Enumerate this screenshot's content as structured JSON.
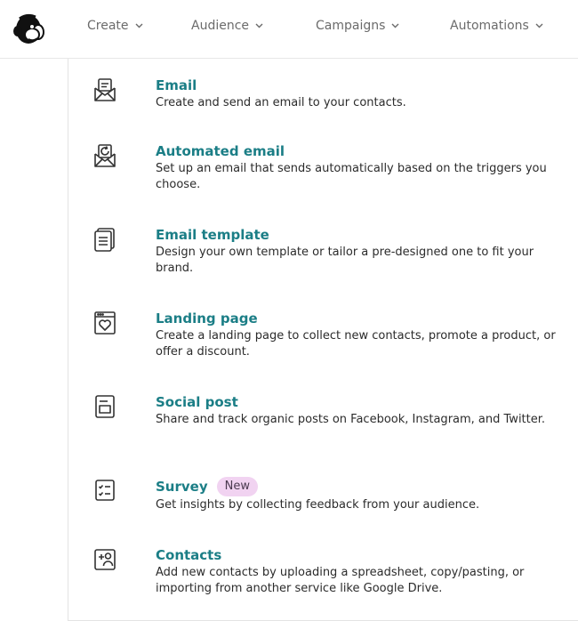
{
  "nav": {
    "items": [
      {
        "label": "Create"
      },
      {
        "label": "Audience"
      },
      {
        "label": "Campaigns"
      },
      {
        "label": "Automations"
      }
    ]
  },
  "menu": {
    "items": [
      {
        "title": "Email",
        "description": "Create and send an email to your contacts.",
        "icon": "envelope-icon"
      },
      {
        "title": "Automated email",
        "description": "Set up an email that sends automatically based on the triggers you choose.",
        "icon": "automated-email-icon"
      },
      {
        "title": "Email template",
        "description": "Design your own template or tailor a pre-designed one to fit your brand.",
        "icon": "template-icon"
      },
      {
        "title": "Landing page",
        "description": "Create a landing page to collect new contacts, promote a product, or offer a discount.",
        "icon": "landing-page-icon"
      },
      {
        "title": "Social post",
        "description": "Share and track organic posts on Facebook, Instagram, and Twitter.",
        "icon": "social-post-icon"
      },
      {
        "title": "Survey",
        "badge": "New",
        "description": "Get insights by collecting feedback from your audience.",
        "icon": "survey-icon"
      },
      {
        "title": "Contacts",
        "description": "Add new contacts by uploading a spreadsheet, copy/pasting, or importing from another service like Google Drive.",
        "icon": "add-contact-icon"
      }
    ]
  },
  "colors": {
    "title": "#1b7e86",
    "badge_bg": "#f1d3f1",
    "nav_text": "#6b6b6b"
  }
}
